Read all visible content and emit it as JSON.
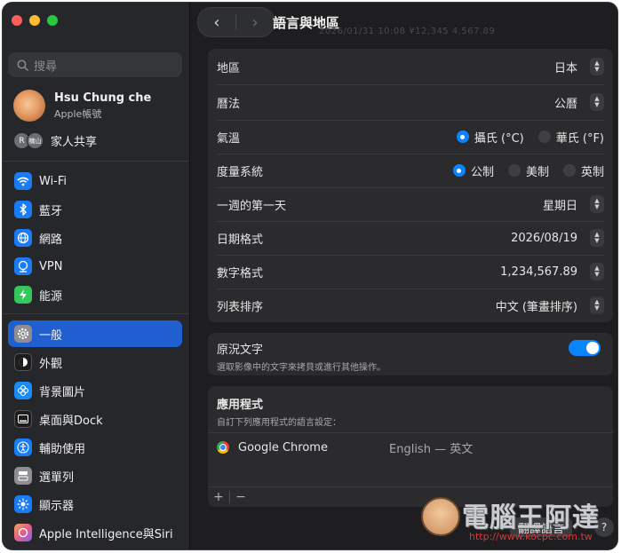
{
  "search": {
    "placeholder": "搜尋"
  },
  "user": {
    "name": "Hsu Chung che",
    "subtitle": "Apple帳號"
  },
  "family": {
    "avatar1": "R",
    "avatar2": "楠山",
    "label": "家人共享"
  },
  "sidebar": {
    "items": [
      {
        "label": "Wi-Fi",
        "icon": "wifi-icon",
        "color": "#1a7cf5",
        "glyph": "≋"
      },
      {
        "label": "藍牙",
        "icon": "bluetooth-icon",
        "color": "#1a7cf5",
        "glyph": "ᛒ"
      },
      {
        "label": "網路",
        "icon": "globe-icon",
        "color": "#1a7cf5",
        "glyph": "◎"
      },
      {
        "label": "VPN",
        "icon": "vpn-icon",
        "color": "#1a7cf5",
        "glyph": "⊕"
      },
      {
        "label": "能源",
        "icon": "battery-icon",
        "color": "#34c759",
        "glyph": "ϟ"
      },
      {
        "label": "一般",
        "icon": "gear-icon",
        "color": "#8e8e93",
        "glyph": "⚙"
      },
      {
        "label": "外觀",
        "icon": "appearance-icon",
        "color": "#1c1c1e",
        "glyph": "◐"
      },
      {
        "label": "背景圖片",
        "icon": "wallpaper-icon",
        "color": "#1a8cf5",
        "glyph": "✿"
      },
      {
        "label": "桌面與Dock",
        "icon": "dock-icon",
        "color": "#1c1c1e",
        "glyph": "▭"
      },
      {
        "label": "輔助使用",
        "icon": "accessibility-icon",
        "color": "#1a7cf5",
        "glyph": "✪"
      },
      {
        "label": "選單列",
        "icon": "menubar-icon",
        "color": "#8e8e93",
        "glyph": "☰"
      },
      {
        "label": "顯示器",
        "icon": "display-icon",
        "color": "#1a7cf5",
        "glyph": "☀"
      },
      {
        "label": "Apple Intelligence與Siri",
        "icon": "siri-icon",
        "color": "#e0608a",
        "glyph": "✦"
      }
    ]
  },
  "toolbar": {
    "back": "‹",
    "forward": "›",
    "title": "語言與地區",
    "ghost_text": "2026/01/31 10:08    ¥12,345    4,567.89"
  },
  "settings": {
    "region": {
      "label": "地區",
      "value": "日本"
    },
    "calendar": {
      "label": "曆法",
      "value": "公曆"
    },
    "temperature": {
      "label": "氣溫",
      "option1": "攝氏 (°C)",
      "option2": "華氏 (°F)",
      "selected": "攝氏 (°C)"
    },
    "measurement": {
      "label": "度量系統",
      "option1": "公制",
      "option2": "美制",
      "option3": "英制",
      "selected": "公制"
    },
    "first_day": {
      "label": "一週的第一天",
      "value": "星期日"
    },
    "date_format": {
      "label": "日期格式",
      "value": "2026/08/19"
    },
    "number_format": {
      "label": "數字格式",
      "value": "1,234,567.89"
    },
    "list_sort": {
      "label": "列表排序",
      "value": "中文 (筆畫排序)"
    }
  },
  "live_text": {
    "title": "原況文字",
    "desc": "選取影像中的文字來拷貝或進行其他操作。",
    "enabled": true
  },
  "apps": {
    "title": "應用程式",
    "desc": "自訂下列應用程式的語言設定：",
    "list": [
      {
        "name": "Google Chrome",
        "language": "English — 英文"
      }
    ],
    "add": "+",
    "remove": "−"
  },
  "footer": {
    "translate_button": "翻譯語言",
    "help": "?"
  },
  "watermark": {
    "text": "電腦王阿達",
    "url": "http://www.kocpc.com.tw"
  }
}
